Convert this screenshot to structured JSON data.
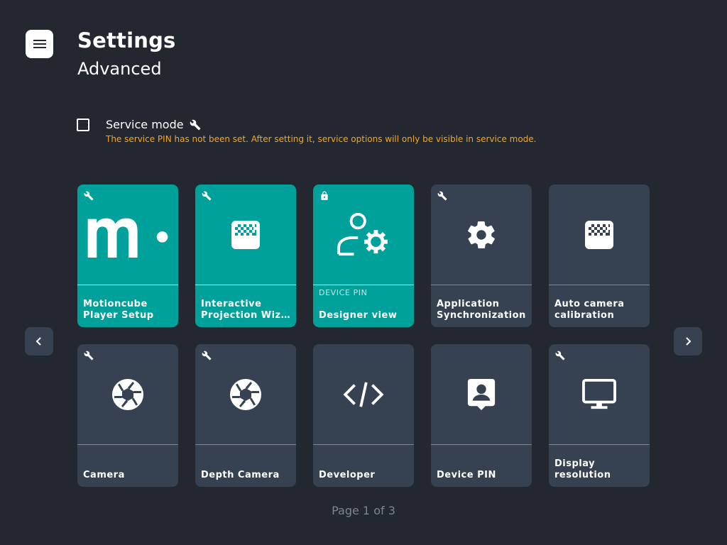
{
  "header": {
    "title": "Settings",
    "subtitle": "Advanced",
    "menu_icon": "hamburger-menu-icon"
  },
  "service_mode": {
    "label": "Service mode",
    "checked": false,
    "icon": "wrench-icon",
    "note": "The service PIN has not been set. After setting it, service options will only be visible in service mode."
  },
  "colors": {
    "background": "#23272f",
    "tile": "#364251",
    "tile_active": "#00a19a",
    "warning": "#f5a623"
  },
  "tiles": [
    {
      "lines": [
        "Motioncube",
        "Player Setup"
      ],
      "kicker": "",
      "badge": "wrench-icon",
      "icon": "motioncube-logo-icon",
      "active": true
    },
    {
      "lines": [
        "Interactive",
        "Projection Wiz…"
      ],
      "kicker": "",
      "badge": "wrench-icon",
      "icon": "calibration-grid-icon",
      "active": true
    },
    {
      "lines": [
        "Designer view"
      ],
      "kicker": "DEVICE PIN",
      "badge": "lock-icon",
      "icon": "designer-view-icon",
      "active": true
    },
    {
      "lines": [
        "Application",
        "Synchronization"
      ],
      "kicker": "",
      "badge": "wrench-icon",
      "icon": "gear-icon",
      "active": false
    },
    {
      "lines": [
        "Auto camera",
        "calibration"
      ],
      "kicker": "",
      "badge": "",
      "icon": "calibration-grid-icon",
      "active": false
    },
    {
      "lines": [
        "Camera"
      ],
      "kicker": "",
      "badge": "wrench-icon",
      "icon": "camera-aperture-icon",
      "active": false
    },
    {
      "lines": [
        "Depth Camera"
      ],
      "kicker": "",
      "badge": "wrench-icon",
      "icon": "camera-aperture-icon",
      "active": false
    },
    {
      "lines": [
        "Developer"
      ],
      "kicker": "",
      "badge": "",
      "icon": "code-icon",
      "active": false
    },
    {
      "lines": [
        "Device PIN"
      ],
      "kicker": "",
      "badge": "",
      "icon": "person-badge-icon",
      "active": false
    },
    {
      "lines": [
        "Display",
        "resolution"
      ],
      "kicker": "",
      "badge": "wrench-icon",
      "icon": "monitor-icon",
      "active": false
    }
  ],
  "navigation": {
    "prev_icon": "chevron-left-icon",
    "next_icon": "chevron-right-icon"
  },
  "pagination": {
    "text": "Page 1 of 3",
    "current": 1,
    "total": 3
  }
}
